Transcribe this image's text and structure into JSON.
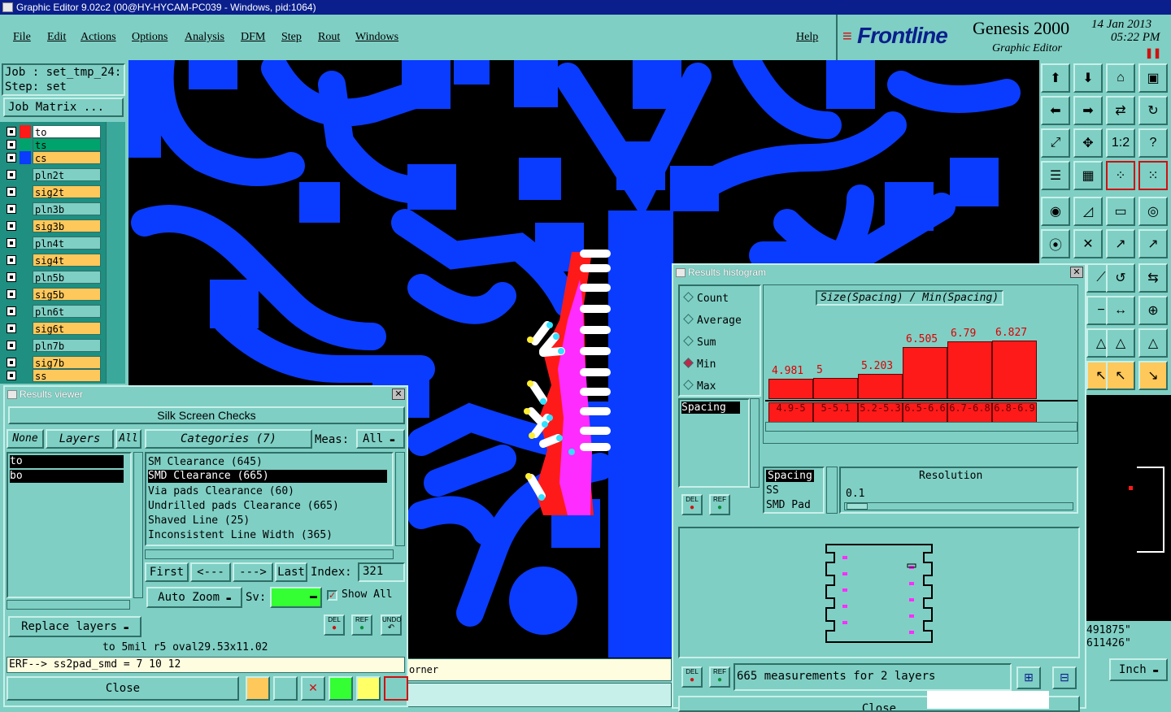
{
  "window": {
    "title": "Graphic Editor 9.02c2 (00@HY-HYCAM-PC039 - Windows, pid:1064)"
  },
  "menu": {
    "items": [
      "File",
      "Edit",
      "Actions",
      "Options",
      "Analysis",
      "DFM",
      "Step",
      "Rout",
      "Windows"
    ],
    "help": "Help"
  },
  "brand": {
    "logo": "Frontline",
    "product": "Genesis 2000",
    "subtitle": "Graphic Editor",
    "date": "14 Jan 2013",
    "time": "05:22 PM"
  },
  "job": {
    "job_label": "Job : set_tmp_24:",
    "step_label": "Step: set",
    "matrix_button": "Job Matrix ..."
  },
  "layers": [
    "to",
    "ts",
    "cs",
    "pln2t",
    "sig2t",
    "pln3b",
    "sig3b",
    "pln4t",
    "sig4t",
    "pln5b",
    "sig5b",
    "pln6t",
    "sig6t",
    "pln7b",
    "sig7b",
    "ss"
  ],
  "layer_colors": {
    "to": "#ff1a1a",
    "ts": "#00a36c",
    "cs": "#0a3cff",
    "board": "#ffc85a",
    "selected_bg": "#ffffff"
  },
  "results_viewer": {
    "title": "Results viewer",
    "heading": "Silk Screen Checks",
    "none_btn": "None",
    "layers_btn": "Layers",
    "all_btn": "All",
    "categories_btn": "Categories (7)",
    "meas_label": "Meas:",
    "meas_value": "All",
    "layer_list": [
      "to",
      "bo"
    ],
    "categories": [
      "SM Clearance (645)",
      "SMD Clearance (665)",
      "Via pads Clearance (60)",
      "Undrilled pads Clearance (665)",
      "Shaved Line (25)",
      "Inconsistent Line Width (365)"
    ],
    "first": "First",
    "prev": "<---",
    "next": "--->",
    "last": "Last",
    "index_label": "Index:",
    "index_value": "321",
    "auto_zoom": "Auto Zoom",
    "sv_label": "Sv:",
    "show_all": "Show All",
    "replace_layers": "Replace layers",
    "info_line": "to 5mil  r5  oval29.53x11.02",
    "erf_line": "ERF--> ss2pad_smd = 7 10 12",
    "close": "Close",
    "del": "DEL",
    "ref": "REF",
    "undo": "UNDO"
  },
  "histogram": {
    "title": "Results histogram",
    "modes": [
      "Count",
      "Average",
      "Sum",
      "Min",
      "Max"
    ],
    "selected_mode": "Min",
    "chart_title": "Size(Spacing) / Min(Spacing)",
    "measure_list": [
      "Spacing"
    ],
    "type_list": [
      "Spacing",
      "SS",
      "SMD Pad"
    ],
    "resolution_label": "Resolution",
    "resolution_value": "0.1",
    "status": "665 measurements for 2 layers",
    "close": "Close"
  },
  "chart_data": {
    "type": "bar",
    "title": "Size(Spacing) / Min(Spacing)",
    "categories": [
      "4.9-5",
      "5-5.1",
      "5.2-5.3",
      "6.5-6.6",
      "6.7-6.8",
      "6.8-6.9"
    ],
    "values": [
      4.981,
      5,
      5.203,
      6.505,
      6.79,
      6.827
    ],
    "value_labels": [
      "4.981",
      "5",
      "5.203",
      "6.505",
      "6.79",
      "6.827"
    ],
    "bar_color": "#ff1a1a"
  },
  "status_bar": {
    "text": "orner",
    "coord_x": "491875\"",
    "coord_y": "611426\"",
    "units": "Inch"
  }
}
